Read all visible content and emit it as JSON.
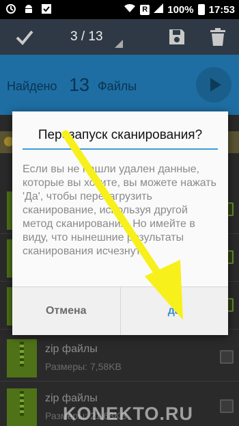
{
  "status_bar": {
    "battery": "100%",
    "time": "17:53",
    "sim_badge": "R"
  },
  "toolbar": {
    "counter": "3 / 13"
  },
  "found": {
    "label": "Найдено",
    "count": "13",
    "unit": "Файлы"
  },
  "dialog": {
    "title": "Перезапуск сканирования?",
    "body": "Если вы не нашли удален данные, которые вы хотите, вы можете нажать 'Да', чтобы перезагрузить сканирование, используя другой метод сканирования. Но имейте в виду, что нынешние результаты сканирования исчезнут.",
    "cancel_label": "Отмена",
    "yes_label": "да"
  },
  "list": {
    "items": [
      {
        "name": "zip файлы",
        "size": "Размеры: 7,58KB"
      },
      {
        "name": "zip файлы",
        "size": "Размеры: 21,68KB"
      }
    ]
  },
  "watermark": "KONEKTO.RU",
  "colors": {
    "accent": "#1e6ea3",
    "dialog_rule": "#3a9bd9",
    "arrow": "#f7f01a"
  }
}
